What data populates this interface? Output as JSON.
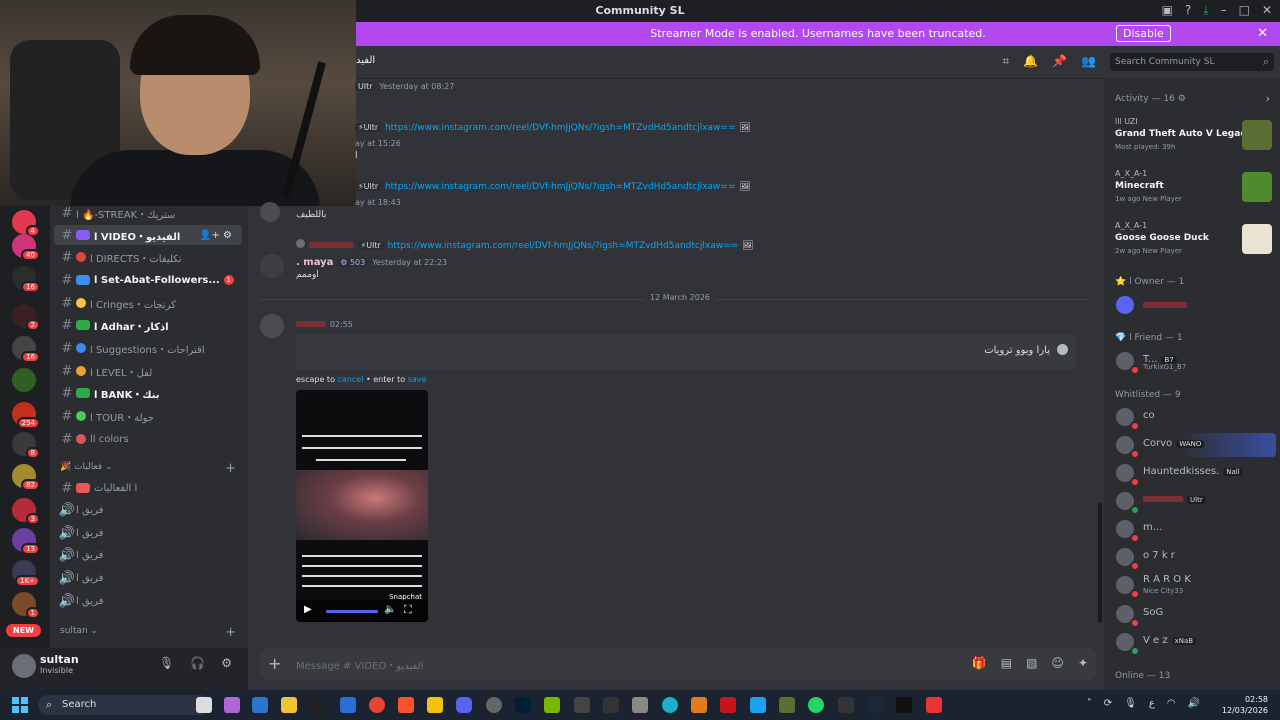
{
  "window": {
    "title": "Community SL"
  },
  "banner": {
    "text": "Streamer Mode is enabled. Usernames have been truncated.",
    "button": "Disable"
  },
  "server_badges": [
    "4",
    "40",
    "16",
    "2",
    "16",
    "",
    "254",
    "8",
    "82",
    "3",
    "13",
    "1K+",
    "1"
  ],
  "server_new": "NEW",
  "channels": [
    {
      "name": "ا ‎🔥-STREAK・ستريك",
      "style": "normal"
    },
    {
      "name": "ا VIDEO・الفيديو",
      "style": "active"
    },
    {
      "name": "ا DIRECTS・تكليفات",
      "style": "normal"
    },
    {
      "name": "ا Set-Abat-Followers...",
      "style": "bold",
      "unread": "1"
    },
    {
      "name": "ا Cringes・كرنجات",
      "style": "normal"
    },
    {
      "name": "ا Adhar・اذكار",
      "style": "bold"
    },
    {
      "name": "ا Suggestions・اقتراحات",
      "style": "normal"
    },
    {
      "name": "ا LEVEL・لفل",
      "style": "normal"
    },
    {
      "name": "ا BANK・بنك",
      "style": "bold"
    },
    {
      "name": "ا TOUR・جولة",
      "style": "normal"
    },
    {
      "name": "اا colors",
      "style": "normal"
    }
  ],
  "category": "فعاليات",
  "voice_channels": [
    "ا الفعاليات",
    "فريق ا",
    "فريق ا",
    "فريق ا",
    "فريق ا",
    "فريق ا"
  ],
  "category2": "sultan",
  "user": {
    "name": "sultan",
    "status": "Invisible"
  },
  "channel_header": {
    "title": "الفيد"
  },
  "search": {
    "placeholder": "Search Community SL"
  },
  "messages": {
    "m1": {
      "tag": "Ultr",
      "time": "Yesterday at 08:27"
    },
    "m2": {
      "tag": "⚡Ultr",
      "link": "https://www.instagram.com/reel/DVf-hmJjQNs/?igsh=MTZvdHd5andtcjlxaw==",
      "time": "ay at 15:26",
      "text": "ا"
    },
    "m3": {
      "tag": "⚡Ultr",
      "link": "https://www.instagram.com/reel/DVf-hmJjQNs/?igsh=MTZvdHd5andtcjlxaw==",
      "time": "ay at 18:43",
      "text": "باللطيف"
    },
    "m4": {
      "tag": "⚡Ultr",
      "link": "https://www.instagram.com/reel/DVf-hmJjQNs/?igsh=MTZvdHd5andtcjlxaw==",
      "author": ". maya",
      "badge": "503",
      "time": "Yesterday at 22:23",
      "text": "اوممم"
    },
    "date_divider": "12 March 2026",
    "m5": {
      "time": "02:55",
      "edit_text": "يارا ويوو ترويات",
      "hint_a": "escape to ",
      "hint_cancel": "cancel",
      "hint_b": " • enter to ",
      "hint_save": "save",
      "video_label": "Snapchat"
    }
  },
  "composer": {
    "placeholder": "Message # VIDEO・الفيديو"
  },
  "members": {
    "activity_label": "Activity — 16",
    "activities": [
      {
        "user": "ااا UZI",
        "game": "Grand Theft Auto V Legacy",
        "sub": "Most played: 39h",
        "color": "#5b6e33"
      },
      {
        "user": "A_X_A-1",
        "game": "Minecraft",
        "sub": "1w ago  New Player",
        "color": "#4f8a2f"
      },
      {
        "user": "A_X_A-1",
        "game": "Goose Goose Duck",
        "sub": "2w ago  New Player",
        "color": "#e9e3d3"
      }
    ],
    "owner_label": "ا Owner — 1",
    "owner": "",
    "friend_label": "ا Friend — 1",
    "friend": {
      "name": "T...",
      "tag": "B7",
      "sub": "TurkixG1_B7"
    },
    "whitelisted_label": "Whitlisted — 9",
    "whitelisted": [
      {
        "name": "co",
        "tag": "",
        "sub": ""
      },
      {
        "name": "Corvo",
        "tag": "WANO",
        "sub": ""
      },
      {
        "name": "Hauntedkisses.",
        "tag": "Nall",
        "sub": ""
      },
      {
        "name": "",
        "tag": "Ultr",
        "sub": ""
      },
      {
        "name": "m...",
        "tag": "",
        "sub": ""
      },
      {
        "name": "o 7 k r",
        "tag": "",
        "sub": ""
      },
      {
        "name": "R A R O K",
        "tag": "",
        "sub": "Nice City33"
      },
      {
        "name": "SoG",
        "tag": "",
        "sub": ""
      },
      {
        "name": "V e z",
        "tag": "xNaB",
        "sub": ""
      }
    ],
    "online_label": "Online — 13"
  },
  "taskbar": {
    "search": "Search",
    "lang": "ع",
    "time": "02:58",
    "date": "12/03/2026"
  },
  "colors": {
    "accent": "#b249ef",
    "link": "#00a8fc",
    "danger": "#f23f43"
  }
}
